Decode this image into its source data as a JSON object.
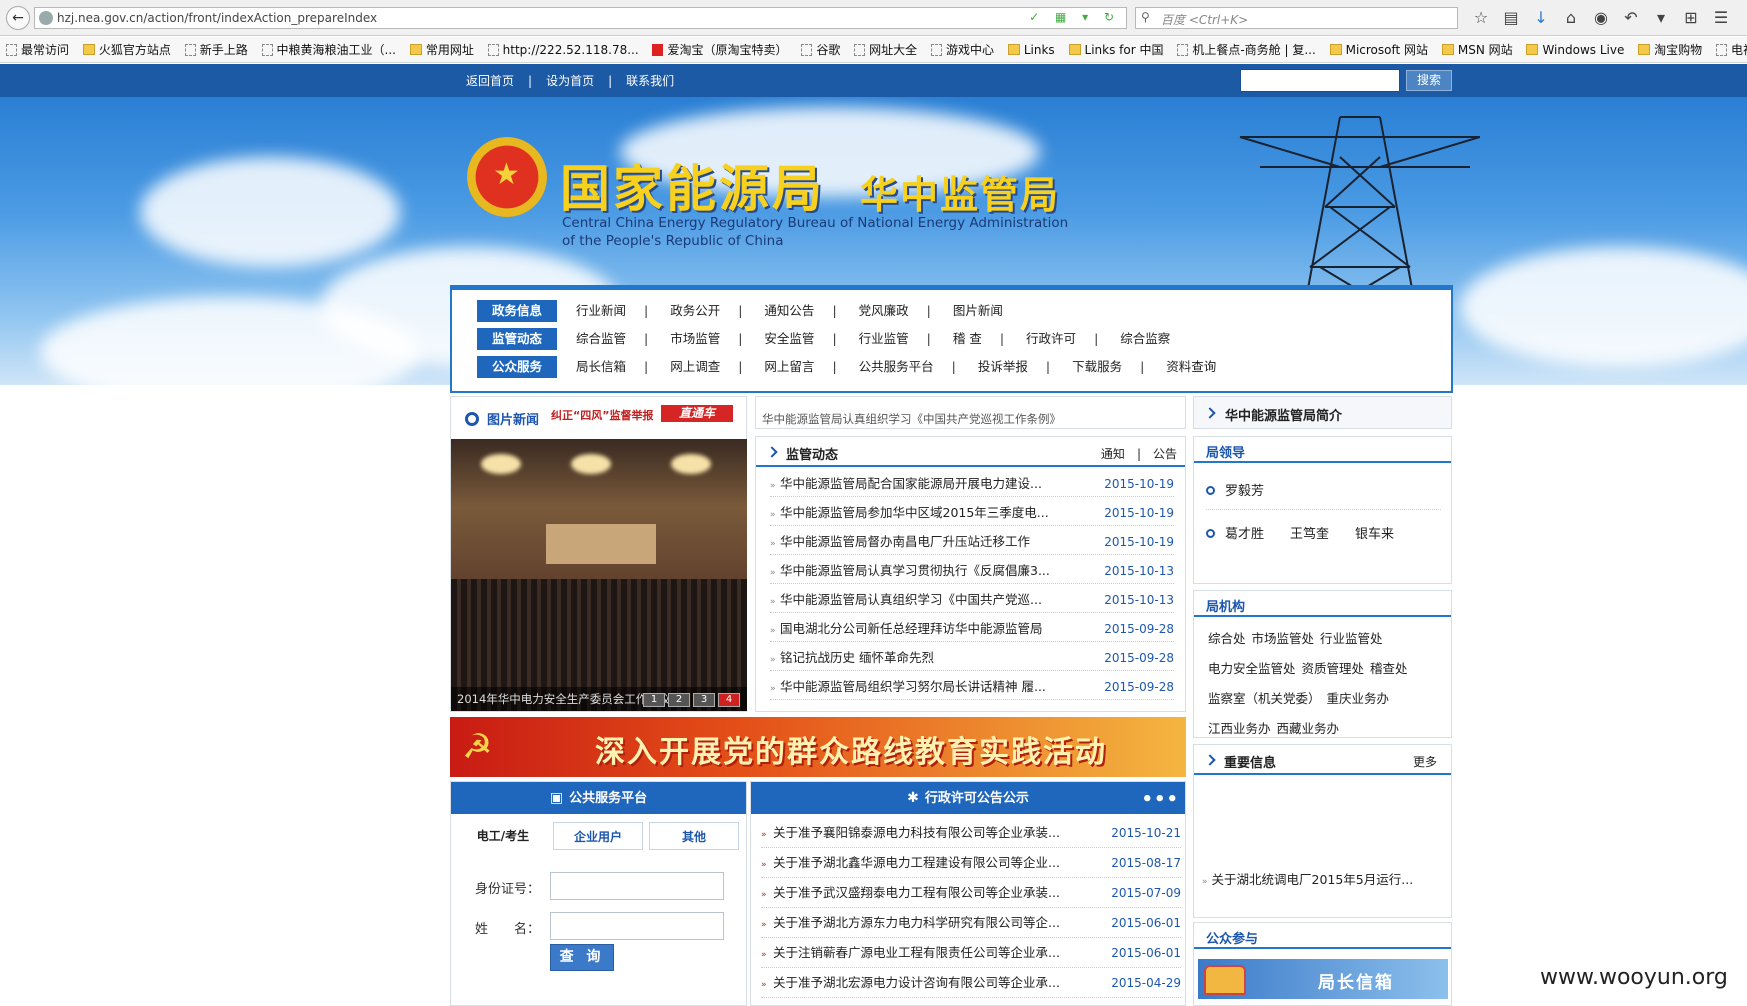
{
  "browser": {
    "url": "hzj.nea.gov.cn/action/front/indexAction_prepareIndex",
    "search_placeholder": "百度 <Ctrl+K>",
    "bookmarks": [
      "最常访问",
      "火狐官方站点",
      "新手上路",
      "中粮黄海粮油工业（...",
      "常用网址",
      "http://222.52.118.78...",
      "爱淘宝（原淘宝特卖）",
      "谷歌",
      "网址大全",
      "游戏中心",
      "Links",
      "Links for 中国",
      "机上餐点-商务舱 | 复...",
      "Microsoft 网站",
      "MSN 网站",
      "Windows Live",
      "淘宝购物",
      "电视网"
    ]
  },
  "site_top": {
    "links": [
      "返回首页",
      "设为首页",
      "联系我们"
    ],
    "search_button": "搜索"
  },
  "banner": {
    "title": "国家能源局",
    "subtitle": "华中监管局",
    "english_name": "Central China Energy Regulatory Bureau of National Energy Administration of the People's Republic of China"
  },
  "nav": {
    "rows": [
      {
        "category": "政务信息",
        "items": [
          "行业新闻",
          "政务公开",
          "通知公告",
          "党风廉政",
          "图片新闻"
        ]
      },
      {
        "category": "监管动态",
        "items": [
          "综合监管",
          "市场监管",
          "安全监管",
          "行业监管",
          "稽 查",
          "行政许可",
          "综合监察"
        ]
      },
      {
        "category": "公众服务",
        "items": [
          "局长信箱",
          "网上调查",
          "网上留言",
          "公共服务平台",
          "投诉举报",
          "下载服务",
          "资料查询"
        ]
      }
    ]
  },
  "picture_news": {
    "title": "图片新闻",
    "tag": "纠正“四风”监督举报",
    "tag_badge": "直通车",
    "caption": "2014年华中电力安全生产委员会工作会议",
    "pages": [
      "1",
      "2",
      "3",
      "4"
    ]
  },
  "headline_scroll": "华中能源监管局认真组织学习《中国共产党巡视工作条例》",
  "regulation": {
    "title": "监管动态",
    "tab_notice": "通知",
    "tab_bulletin": "公告",
    "items": [
      {
        "title": "华中能源监管局配合国家能源局开展电力建设...",
        "date": "2015-10-19"
      },
      {
        "title": "华中能源监管局参加华中区域2015年三季度电...",
        "date": "2015-10-19"
      },
      {
        "title": "华中能源监管局督办南昌电厂升压站迁移工作",
        "date": "2015-10-19"
      },
      {
        "title": "华中能源监管局认真学习贯彻执行《反腐倡廉3...",
        "date": "2015-10-13"
      },
      {
        "title": "华中能源监管局认真组织学习《中国共产党巡...",
        "date": "2015-10-13"
      },
      {
        "title": "国电湖北分公司新任总经理拜访华中能源监管局",
        "date": "2015-09-28"
      },
      {
        "title": "铭记抗战历史 缅怀革命先烈",
        "date": "2015-09-28"
      },
      {
        "title": "华中能源监管局组织学习努尔局长讲话精神 履...",
        "date": "2015-09-28"
      }
    ]
  },
  "right": {
    "intro": "华中能源监管局简介",
    "leaders_title": "局领导",
    "leader_main": "罗毅芳",
    "leaders_other": [
      "葛才胜",
      "王笃奎",
      "银车来"
    ],
    "org_title": "局机构",
    "org_lines": [
      [
        "综合处",
        "市场监管处",
        "行业监管处"
      ],
      [
        "电力安全监管处",
        "资质管理处",
        "稽查处"
      ],
      [
        "监察室（机关党委）",
        "重庆业务办"
      ],
      [
        "江西业务办",
        "西藏业务办"
      ]
    ],
    "important_title": "重要信息",
    "important_more": "更多",
    "important_item": "关于湖北统调电厂2015年5月运行...",
    "public_title": "公众参与",
    "mailbox": "局长信箱"
  },
  "party_banner": "深入开展党的群众路线教育实践活动",
  "service": {
    "title": "公共服务平台",
    "tabs": [
      "电工/考生",
      "企业用户",
      "其他"
    ],
    "id_label": "身份证号：",
    "name_label": "姓　　名：",
    "button": "查 询"
  },
  "license": {
    "title": "行政许可公告公示",
    "items": [
      {
        "title": "关于准予襄阳锦泰源电力科技有限公司等企业承装...",
        "date": "2015-10-21"
      },
      {
        "title": "关于准予湖北鑫华源电力工程建设有限公司等企业...",
        "date": "2015-08-17"
      },
      {
        "title": "关于准予武汉盛翔泰电力工程有限公司等企业承装...",
        "date": "2015-07-09"
      },
      {
        "title": "关于准予湖北方源东力电力科学研究有限公司等企...",
        "date": "2015-06-01"
      },
      {
        "title": "关于注销蕲春广源电业工程有限责任公司等企业承...",
        "date": "2015-06-01"
      },
      {
        "title": "关于准予湖北宏源电力设计咨询有限公司等企业承...",
        "date": "2015-04-29"
      }
    ]
  },
  "watermark": "www.wooyun.org"
}
